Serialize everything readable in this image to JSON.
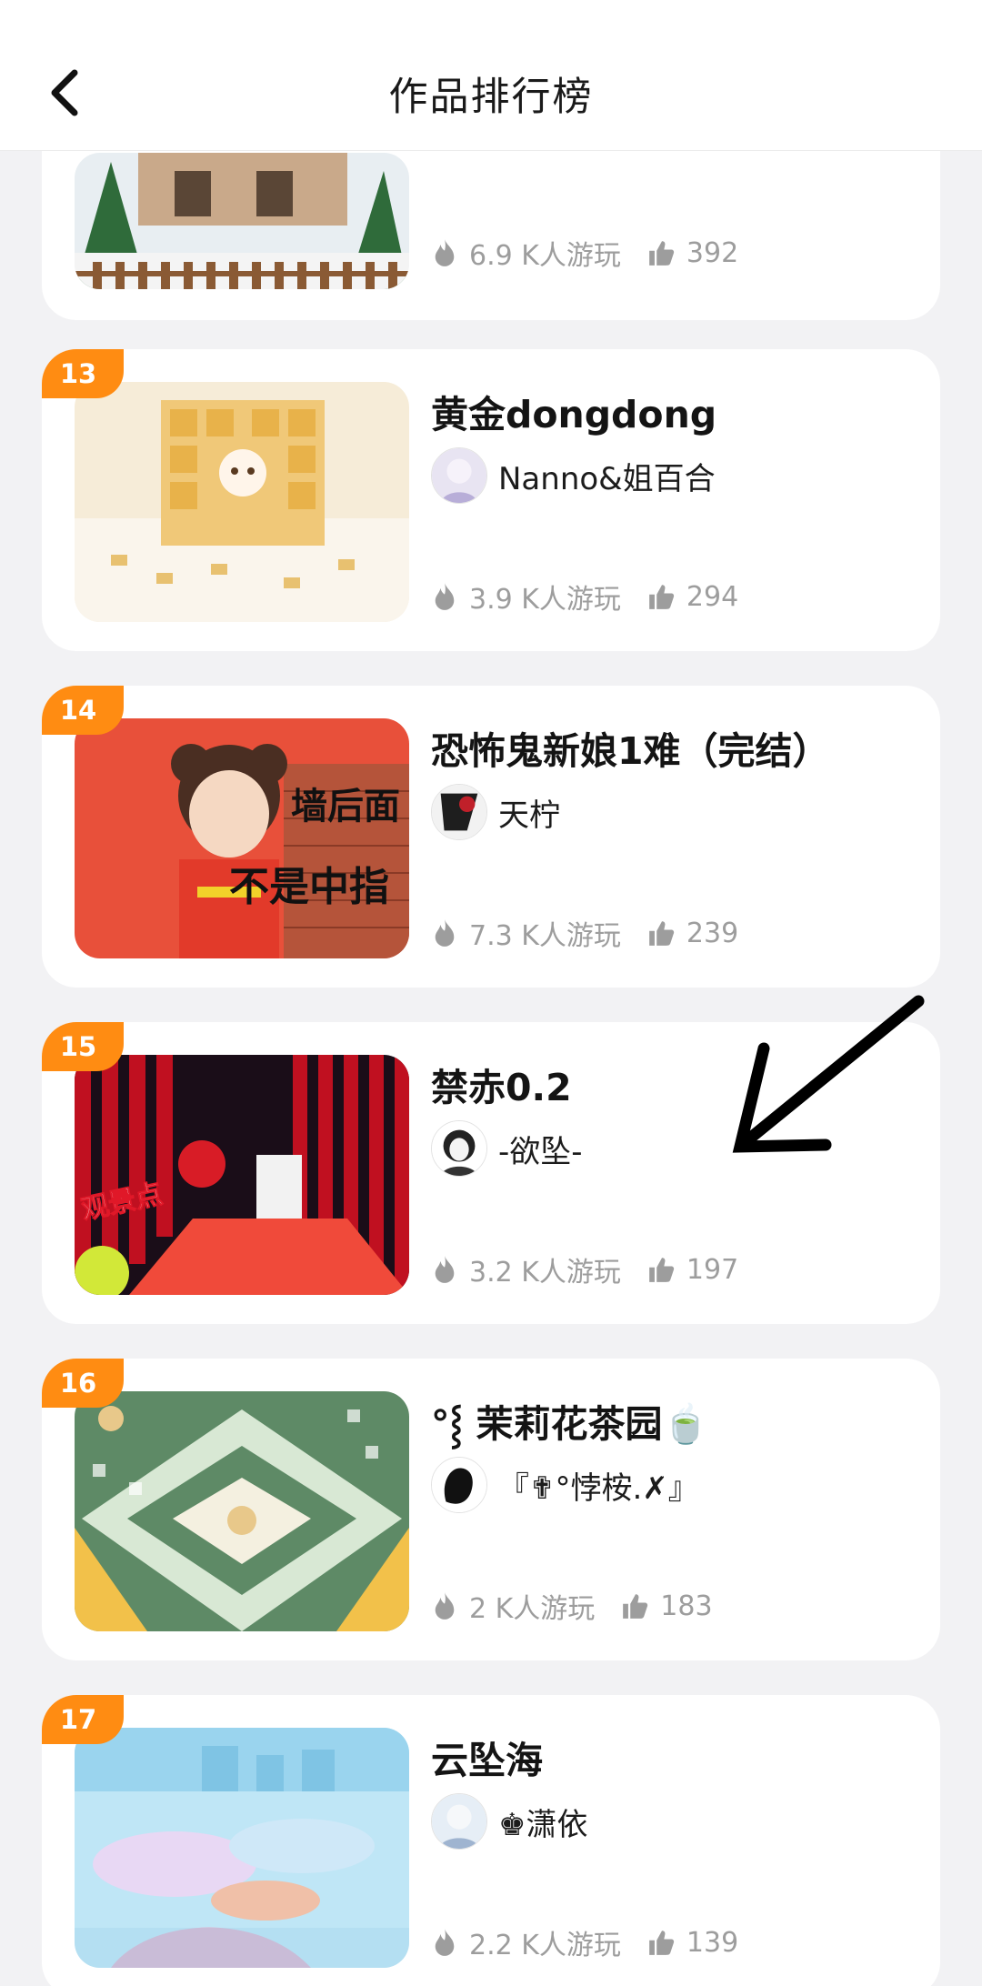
{
  "header": {
    "title": "作品排行榜"
  },
  "items": [
    {
      "rank": "",
      "title": "",
      "author": "",
      "plays": "6.9 K人游玩",
      "likes": "392"
    },
    {
      "rank": "13",
      "title": "黄金dongdong",
      "author": "Nanno&姐百合",
      "plays": "3.9 K人游玩",
      "likes": "294"
    },
    {
      "rank": "14",
      "title": "恐怖鬼新娘1难（完结）",
      "author": "天柠",
      "plays": "7.3 K人游玩",
      "likes": "239",
      "thumb_text_1": "墙后面",
      "thumb_text_2": "不是中指"
    },
    {
      "rank": "15",
      "title": "禁赤0.2",
      "author": "-欲坠-",
      "plays": "3.2 K人游玩",
      "likes": "197",
      "thumb_text_1": "观景点"
    },
    {
      "rank": "16",
      "title": "°⸾ 茉莉花茶园🍵",
      "author": "『✟°悖桉.✗』",
      "plays": "2 K人游玩",
      "likes": "183"
    },
    {
      "rank": "17",
      "title": "云坠海",
      "author": "♚潇依",
      "plays": "2.2 K人游玩",
      "likes": "139"
    }
  ],
  "colors": {
    "accent": "#ff8c12",
    "stat_gray": "#9d9d9d",
    "background": "#f2f2f4"
  }
}
